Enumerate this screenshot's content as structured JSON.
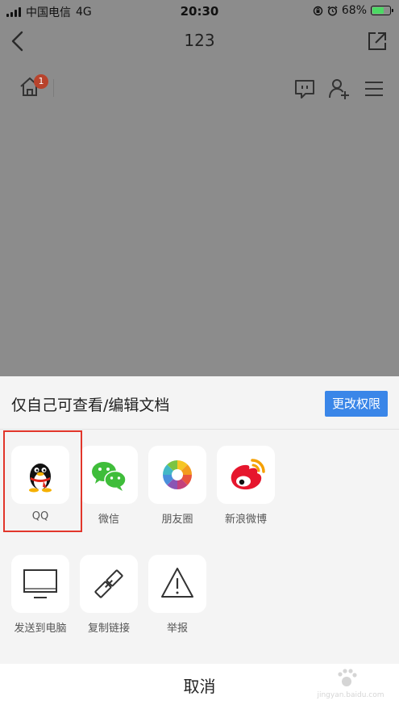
{
  "status_bar": {
    "carrier": "中国电信",
    "network": "4G",
    "time": "20:30",
    "battery": "68%",
    "battery_level": 0.68
  },
  "nav": {
    "title": "123",
    "back_icon": "chevron-left-icon",
    "share_icon": "share-out-icon"
  },
  "doc_toolbar": {
    "home_badge": "1",
    "icons": [
      "home-icon",
      "comment-icon",
      "add-user-icon",
      "menu-icon"
    ]
  },
  "sheet": {
    "permission_text": "仅自己可查看/编辑文档",
    "change_permission_button": "更改权限",
    "share_targets": [
      {
        "label": "QQ",
        "icon": "qq-penguin-icon"
      },
      {
        "label": "微信",
        "icon": "wechat-icon"
      },
      {
        "label": "朋友圈",
        "icon": "moments-aperture-icon"
      },
      {
        "label": "新浪微博",
        "icon": "weibo-icon"
      }
    ],
    "actions": [
      {
        "label": "发送到电脑",
        "icon": "monitor-icon"
      },
      {
        "label": "复制链接",
        "icon": "link-icon"
      },
      {
        "label": "举报",
        "icon": "warning-icon"
      }
    ],
    "cancel_label": "取消"
  },
  "watermark": {
    "text": "jingyan.baidu.com"
  },
  "colors": {
    "accent_button": "#3a86e8",
    "highlight_box": "#e2362b",
    "badge": "#b8432c",
    "battery_fill": "#4cd964"
  }
}
